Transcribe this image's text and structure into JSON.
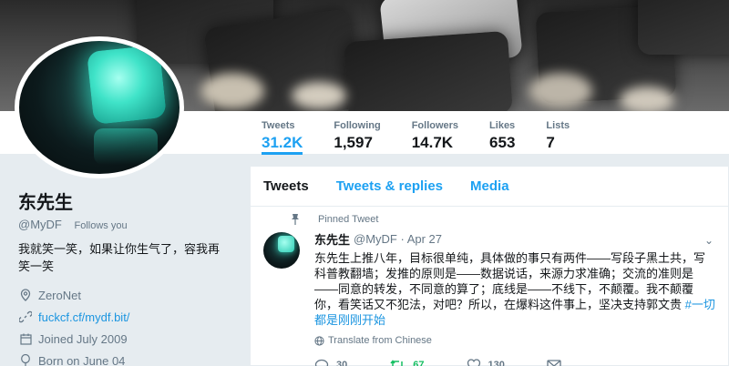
{
  "stats": [
    {
      "label": "Tweets",
      "value": "31.2K"
    },
    {
      "label": "Following",
      "value": "1,597"
    },
    {
      "label": "Followers",
      "value": "14.7K"
    },
    {
      "label": "Likes",
      "value": "653"
    },
    {
      "label": "Lists",
      "value": "7"
    }
  ],
  "profile": {
    "name": "东先生",
    "handle": "@MyDF",
    "follows_you": "Follows you",
    "bio": "我就笑一笑，如果让你生气了，容我再笑一笑",
    "location": "ZeroNet",
    "website": "fuckcf.cf/mydf.bit/",
    "joined": "Joined July 2009",
    "born": "Born on June 04"
  },
  "tabs": [
    "Tweets",
    "Tweets & replies",
    "Media"
  ],
  "tweet": {
    "pinned_label": "Pinned Tweet",
    "name": "东先生",
    "handle_date": "@MyDF · Apr 27",
    "text": "东先生上推八年，目标很单纯，具体做的事只有两件——写段子黑土共，写科普教翻墙；发推的原则是——数据说话，来源力求准确；交流的准则是——同意的转发，不同意的算了；底线是——不线下，不颠覆。我不颠覆你，看笑话又不犯法，对吧？所以，在爆料这件事上，坚决支持郭文贵 ",
    "hashtag": "#一切都是刚刚开始",
    "translate": "Translate from Chinese",
    "replies": "30",
    "retweets": "67",
    "likes": "130"
  },
  "colors": {
    "accent": "#1da1f2",
    "retweet": "#17bf63",
    "muted": "#657786"
  }
}
